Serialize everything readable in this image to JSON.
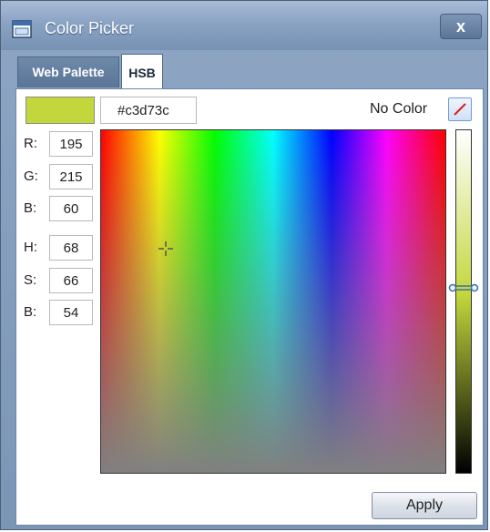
{
  "window": {
    "title": "Color Picker",
    "close_label": "x"
  },
  "tabs": [
    {
      "label": "Web Palette",
      "active": false
    },
    {
      "label": "HSB",
      "active": true
    }
  ],
  "color": {
    "hex": "#c3d73c",
    "swatch": "#c3d73c"
  },
  "no_color": {
    "label": "No Color",
    "icon": "no-color-slash-icon"
  },
  "fields": {
    "r": {
      "label": "R:",
      "value": "195"
    },
    "g": {
      "label": "G:",
      "value": "215"
    },
    "b": {
      "label": "B:",
      "value": "60"
    },
    "h": {
      "label": "H:",
      "value": "68"
    },
    "s": {
      "label": "S:",
      "value": "66"
    },
    "br": {
      "label": "B:",
      "value": "54"
    }
  },
  "apply_label": "Apply",
  "colors": {
    "titlebar": "#8aa3c3",
    "accent": "#c3d73c"
  }
}
